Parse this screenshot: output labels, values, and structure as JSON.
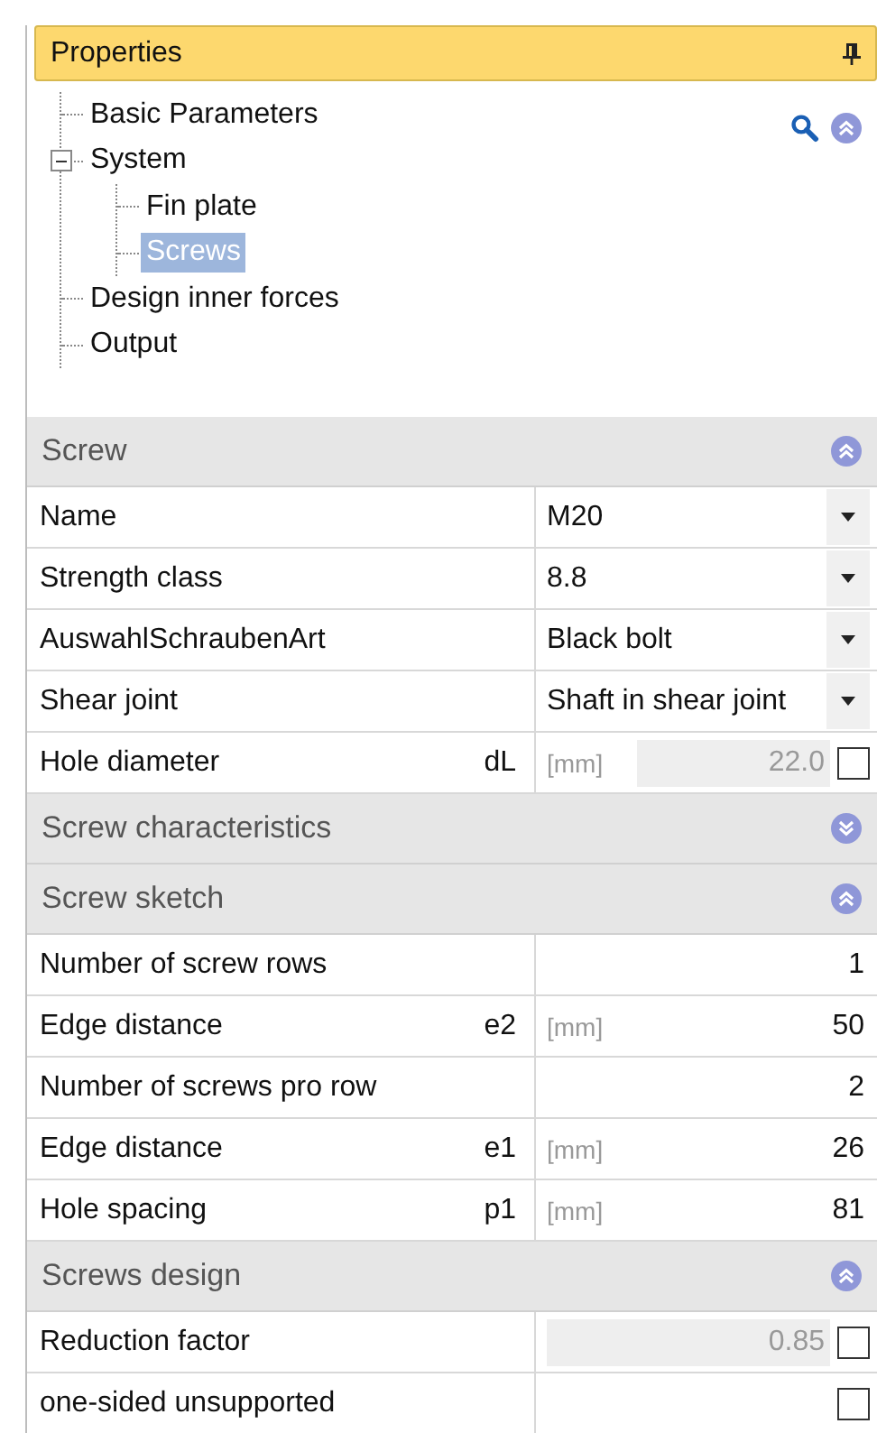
{
  "panel": {
    "title": "Properties"
  },
  "tree": [
    {
      "label": "Basic Parameters",
      "selected": false
    },
    {
      "label": "System",
      "selected": false,
      "expanded": true,
      "children": [
        {
          "label": "Fin plate",
          "selected": false
        },
        {
          "label": "Screws",
          "selected": true
        }
      ]
    },
    {
      "label": "Design inner forces",
      "selected": false
    },
    {
      "label": "Output",
      "selected": false
    }
  ],
  "sections": [
    {
      "title": "Screw",
      "expanded": true,
      "rows": [
        {
          "kind": "dropdown",
          "label": "Name",
          "value": "M20"
        },
        {
          "kind": "dropdown",
          "label": "Strength class",
          "value": "8.8"
        },
        {
          "kind": "dropdown",
          "label": "AuswahlSchraubenArt",
          "value": "Black bolt"
        },
        {
          "kind": "dropdown",
          "label": "Shear joint",
          "value": "Shaft in shear joint"
        },
        {
          "kind": "input",
          "label": "Hole diameter",
          "symbol": "dL",
          "unit": "[mm]",
          "value": "22.0",
          "disabled": true,
          "checked": false
        }
      ]
    },
    {
      "title": "Screw characteristics",
      "expanded": false
    },
    {
      "title": "Screw sketch",
      "expanded": true,
      "rows": [
        {
          "kind": "input",
          "label": "Number of screw rows",
          "value": "1",
          "disabled": false
        },
        {
          "kind": "input",
          "label": "Edge distance",
          "symbol": "e2",
          "unit": "[mm]",
          "value": "50",
          "disabled": false
        },
        {
          "kind": "input",
          "label": "Number of screws pro row",
          "value": "2",
          "disabled": false
        },
        {
          "kind": "input",
          "label": "Edge distance",
          "symbol": "e1",
          "unit": "[mm]",
          "value": "26",
          "disabled": false
        },
        {
          "kind": "input",
          "label": "Hole spacing",
          "symbol": "p1",
          "unit": "[mm]",
          "value": "81",
          "disabled": false
        }
      ]
    },
    {
      "title": "Screws design",
      "expanded": true,
      "rows": [
        {
          "kind": "input",
          "label": "Reduction factor",
          "value": "0.85",
          "disabled": true,
          "checked": false
        },
        {
          "kind": "checkbox",
          "label": "one-sided unsupported",
          "checked": false
        }
      ]
    }
  ]
}
